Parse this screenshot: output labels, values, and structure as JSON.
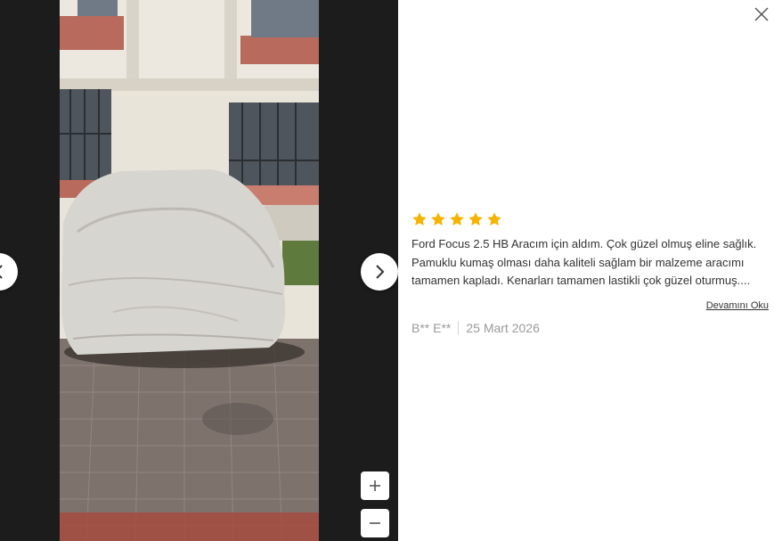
{
  "review": {
    "rating": 5,
    "rating_max": 5,
    "text": "Ford Focus 2.5 HB Aracım için aldım. Çok güzel olmuş eline sağlık. Pamuklu kumaş olması daha kaliteli sağlam bir malzeme aracımı tamamen kapladı. Kenarları tamamen lastikli çok güzel oturmuş....",
    "read_more_label": "Devamını Oku",
    "author": "B** E**",
    "date": "25 Mart 2026"
  },
  "colors": {
    "star": "#f5b400",
    "viewer_background": "#1c1c1c"
  },
  "icons": {
    "close": "close-icon",
    "prev": "chevron-left-icon",
    "next": "chevron-right-icon",
    "zoom_in": "plus-icon",
    "zoom_out": "minus-icon",
    "star": "star-icon"
  }
}
